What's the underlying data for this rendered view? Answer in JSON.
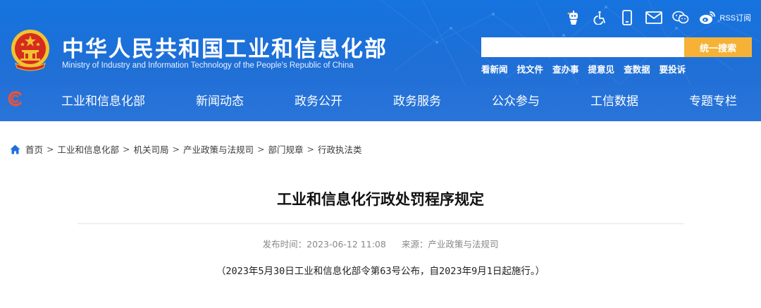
{
  "header": {
    "site_title": "中华人民共和国工业和信息化部",
    "site_subtitle": "Ministry of Industry and Information Technology of the People's Republic of China",
    "top_icons": [
      "robot-icon",
      "accessibility-icon",
      "mobile-icon",
      "mail-icon",
      "wechat-icon",
      "weibo-icon"
    ],
    "rss_label": "RSS订阅",
    "search": {
      "placeholder": "",
      "button_label": "统一搜索"
    },
    "quick_links": [
      "看新闻",
      "找文件",
      "查办事",
      "提意见",
      "查数据",
      "要投诉"
    ]
  },
  "nav": {
    "items": [
      "工业和信息化部",
      "新闻动态",
      "政务公开",
      "政务服务",
      "公众参与",
      "工信数据",
      "专题专栏"
    ]
  },
  "breadcrumb": {
    "items": [
      "首页",
      "工业和信息化部",
      "机关司局",
      "产业政策与法规司",
      "部门规章",
      "行政执法类"
    ],
    "separator": ">"
  },
  "article": {
    "title": "工业和信息化行政处罚程序规定",
    "publish_label": "发布时间：",
    "publish_time": "2023-06-12 11:08",
    "source_label": "来源：",
    "source": "产业政策与法规司",
    "notice": "（2023年5月30日工业和信息化部令第63号公布，自2023年9月1日起施行。）"
  },
  "colors": {
    "header_blue": "#1f6fd6",
    "search_button": "#f5b236",
    "emblem_red": "#d62b1f",
    "emblem_gold": "#f2c230"
  }
}
